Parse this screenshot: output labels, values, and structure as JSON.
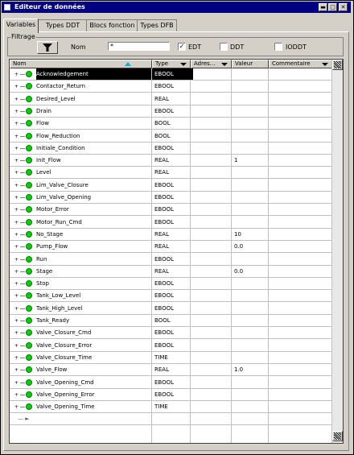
{
  "window": {
    "title": "Editeur de données"
  },
  "tabs": [
    {
      "label": "Variables",
      "active": true
    },
    {
      "label": "Types DDT",
      "active": false
    },
    {
      "label": "Blocs fonction",
      "active": false
    },
    {
      "label": "Types DFB",
      "active": false
    }
  ],
  "filter": {
    "legend": "Filtrage",
    "name_label": "Nom",
    "name_value": "*",
    "edt_label": "EDT",
    "edt_checked": true,
    "ddt_label": "DDT",
    "ddt_checked": false,
    "ioddt_label": "IODDT",
    "ioddt_checked": false
  },
  "columns": {
    "name": "Nom",
    "type": "Type",
    "address": "Adres...",
    "value": "Valeur",
    "comment": "Commentaire"
  },
  "rows": [
    {
      "name": "Acknowledgement",
      "type": "EBOOL",
      "value": "",
      "selected": true
    },
    {
      "name": "Contactor_Return",
      "type": "EBOOL",
      "value": ""
    },
    {
      "name": "Desired_Level",
      "type": "REAL",
      "value": ""
    },
    {
      "name": "Drain",
      "type": "EBOOL",
      "value": ""
    },
    {
      "name": "Flow",
      "type": "BOOL",
      "value": ""
    },
    {
      "name": "Flow_Reduction",
      "type": "BOOL",
      "value": ""
    },
    {
      "name": "Initiale_Condition",
      "type": "EBOOL",
      "value": ""
    },
    {
      "name": "Init_Flow",
      "type": "REAL",
      "value": "1"
    },
    {
      "name": "Level",
      "type": "REAL",
      "value": ""
    },
    {
      "name": "Lim_Valve_Closure",
      "type": "EBOOL",
      "value": ""
    },
    {
      "name": "Lim_Valve_Opening",
      "type": "EBOOL",
      "value": ""
    },
    {
      "name": "Motor_Error",
      "type": "EBOOL",
      "value": ""
    },
    {
      "name": "Motor_Run_Cmd",
      "type": "EBOOL",
      "value": ""
    },
    {
      "name": "No_Stage",
      "type": "REAL",
      "value": "10"
    },
    {
      "name": "Pump_Flow",
      "type": "REAL",
      "value": "0.0"
    },
    {
      "name": "Run",
      "type": "EBOOL",
      "value": ""
    },
    {
      "name": "Stage",
      "type": "REAL",
      "value": "0.0"
    },
    {
      "name": "Stop",
      "type": "EBOOL",
      "value": ""
    },
    {
      "name": "Tank_Low_Level",
      "type": "EBOOL",
      "value": ""
    },
    {
      "name": "Tank_High_Level",
      "type": "EBOOL",
      "value": ""
    },
    {
      "name": "Tank_Ready",
      "type": "BOOL",
      "value": ""
    },
    {
      "name": "Valve_Closure_Cmd",
      "type": "EBOOL",
      "value": ""
    },
    {
      "name": "Valve_Closure_Error",
      "type": "EBOOL",
      "value": ""
    },
    {
      "name": "Valve_Closure_Time",
      "type": "TIME",
      "value": ""
    },
    {
      "name": "Valve_Flow",
      "type": "REAL",
      "value": "1.0"
    },
    {
      "name": "Valve_Opening_Cmd",
      "type": "EBOOL",
      "value": ""
    },
    {
      "name": "Valve_Opening_Error",
      "type": "EBOOL",
      "value": ""
    },
    {
      "name": "Valve_Opening_Time",
      "type": "TIME",
      "value": ""
    }
  ]
}
